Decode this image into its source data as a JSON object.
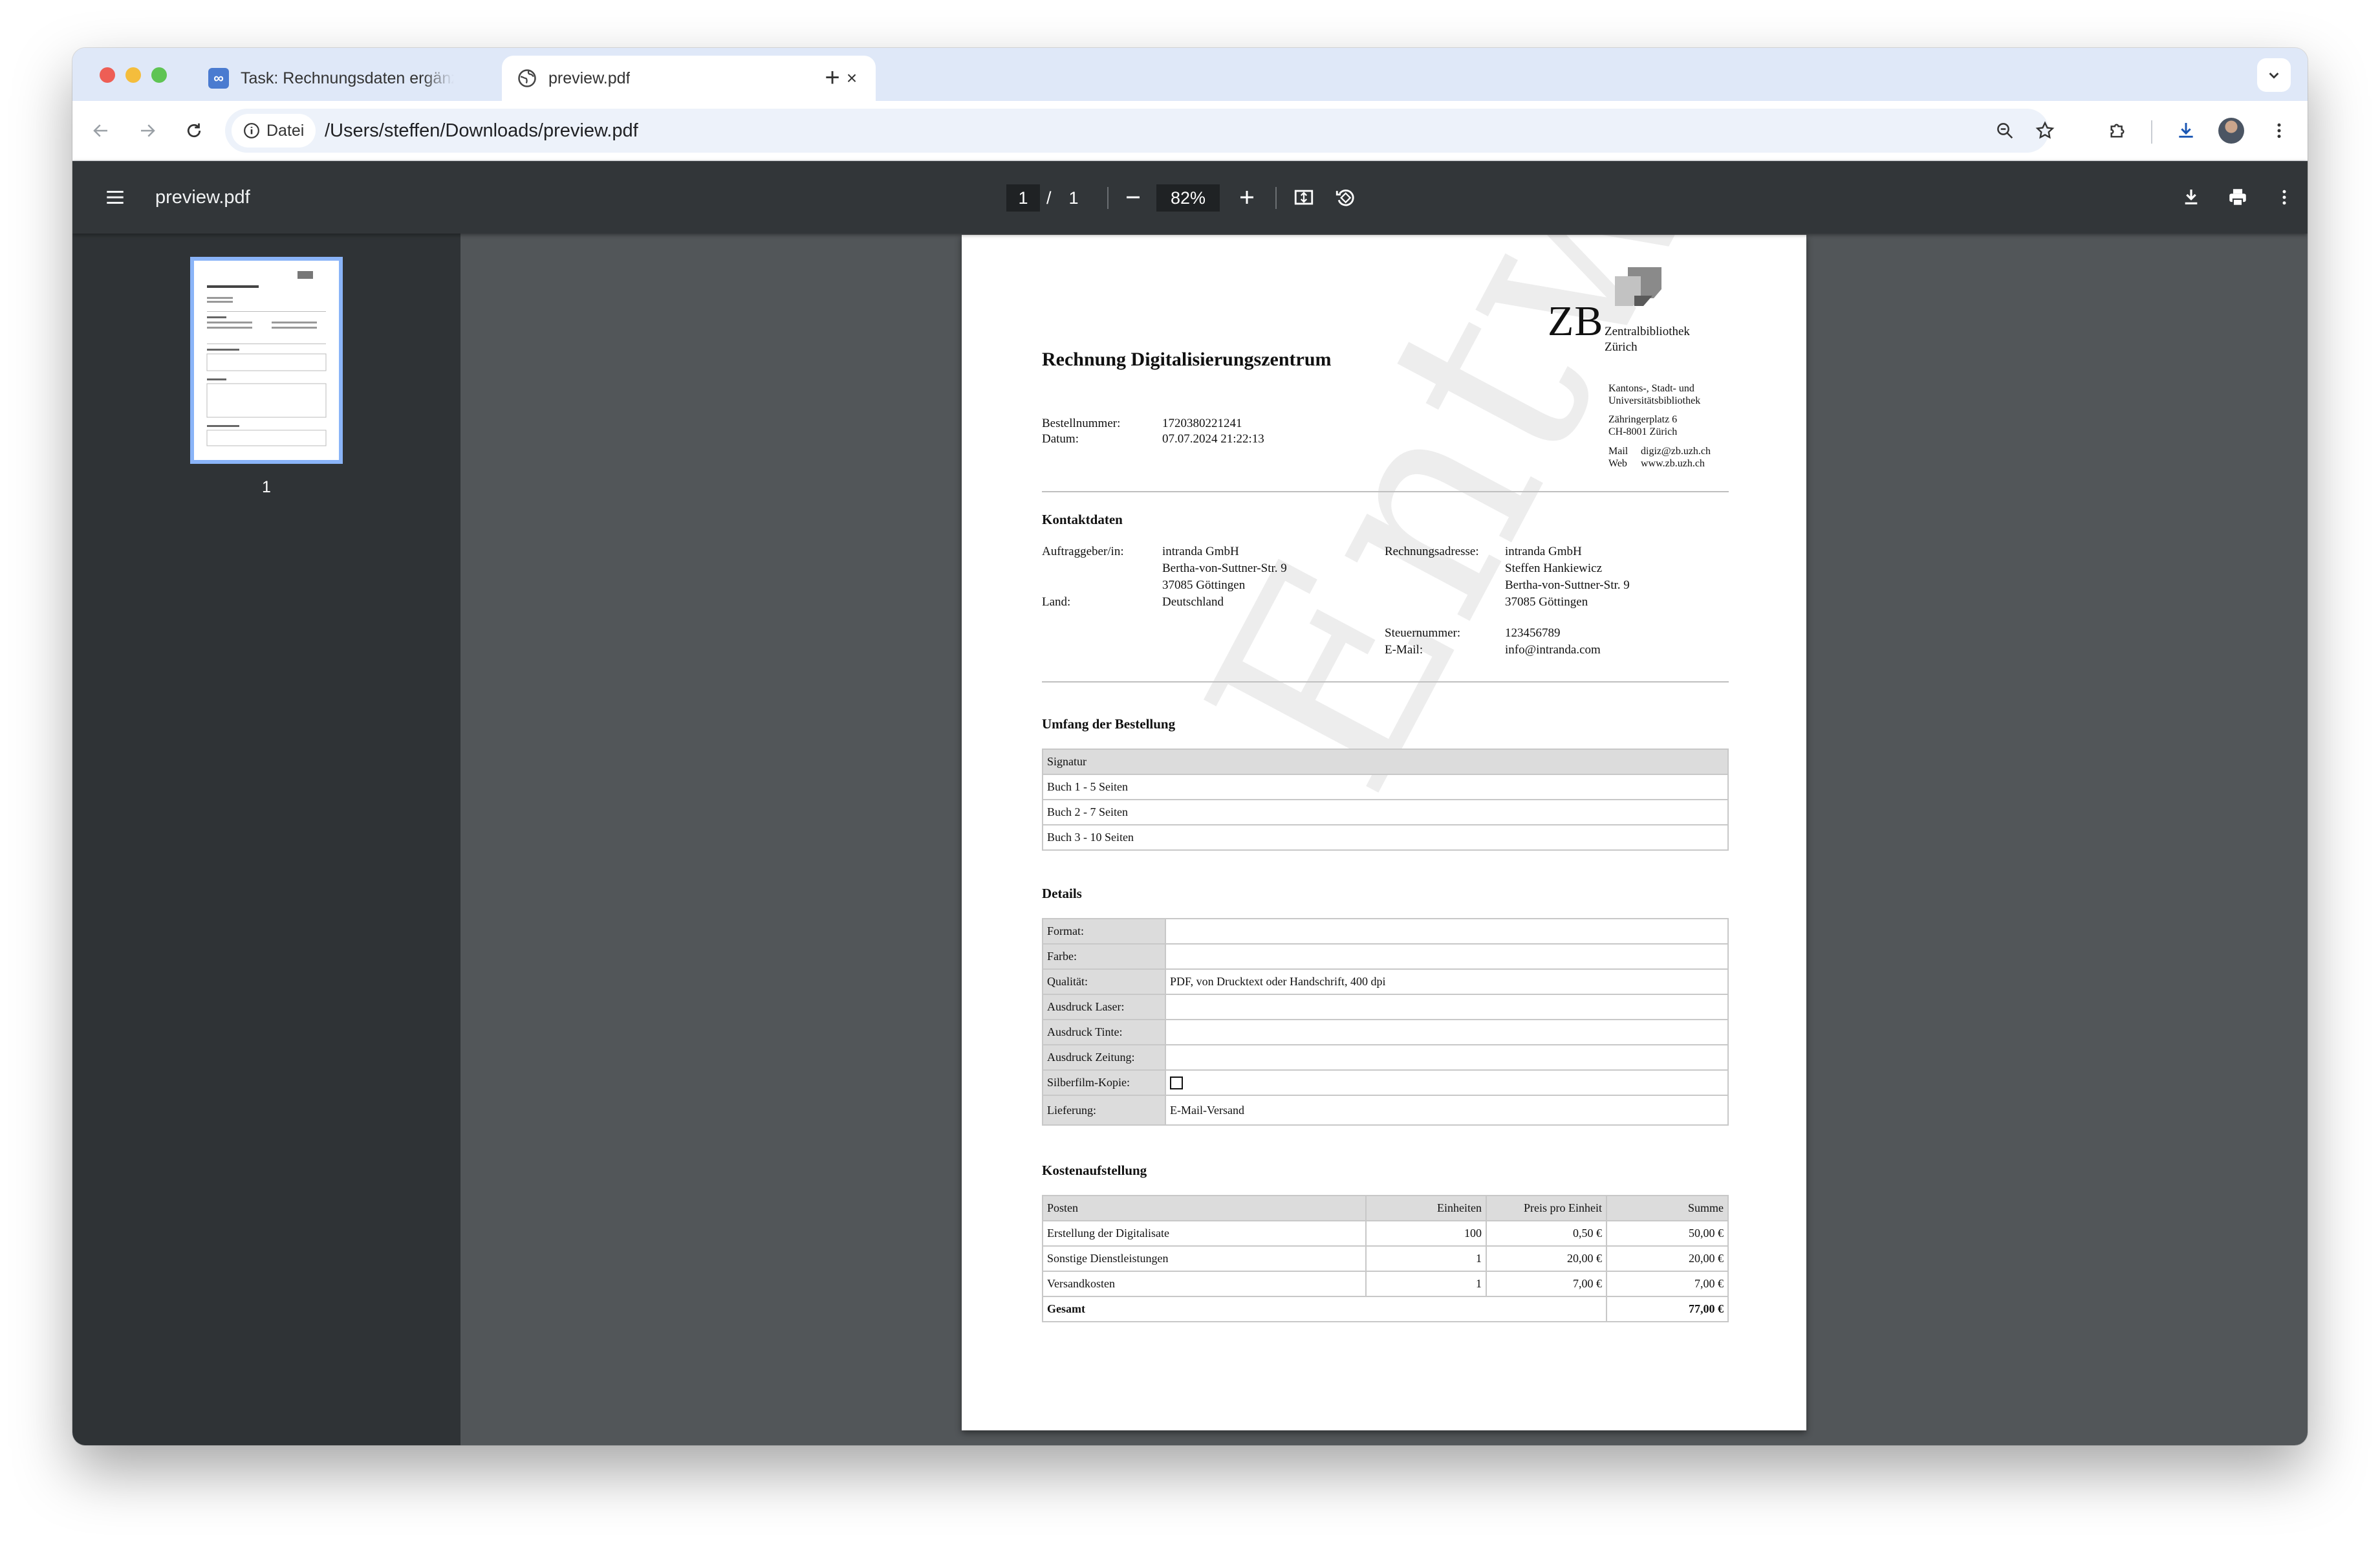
{
  "browser": {
    "tabs": [
      {
        "title": "Task: Rechnungsdaten ergänzen",
        "active": false
      },
      {
        "title": "preview.pdf",
        "active": true
      }
    ],
    "address": {
      "chip_label": "Datei",
      "url": "/Users/steffen/Downloads/preview.pdf"
    }
  },
  "viewer": {
    "title": "preview.pdf",
    "current_page": "1",
    "page_separator": "/",
    "total_pages": "1",
    "zoom": "82%",
    "thumbnail_label": "1"
  },
  "document": {
    "title": "Rechnung Digitalisierungszentrum",
    "logo": {
      "letters": "ZB",
      "line1": "Zentralbibliothek",
      "line2": "Zürich"
    },
    "library": {
      "line1": "Kantons-, Stadt- und",
      "line2": "Universitätsbibliothek",
      "street": "Zähringerplatz 6",
      "city": "CH-8001 Zürich",
      "mail_label": "Mail",
      "mail": "digiz@zb.uzh.ch",
      "web_label": "Web",
      "web": "www.zb.uzh.ch"
    },
    "order": {
      "number_label": "Bestellnummer:",
      "number": "1720380221241",
      "date_label": "Datum:",
      "date": "07.07.2024 21:22:13"
    },
    "contact": {
      "heading": "Kontaktdaten",
      "client_label": "Auftraggeber/in:",
      "client_lines": [
        "intranda GmbH",
        "Bertha-von-Suttner-Str. 9",
        "37085 Göttingen"
      ],
      "country_label": "Land:",
      "country": "Deutschland",
      "billing_label": "Rechnungsadresse:",
      "billing_lines": [
        "intranda GmbH",
        "Steffen Hankiewicz",
        "Bertha-von-Suttner-Str. 9",
        "37085 Göttingen"
      ],
      "tax_label": "Steuernummer:",
      "tax": "123456789",
      "email_label": "E-Mail:",
      "email": "info@intranda.com"
    },
    "scope": {
      "heading": "Umfang der Bestellung",
      "header": "Signatur",
      "rows": [
        "Buch 1 - 5 Seiten",
        "Buch 2 - 7 Seiten",
        "Buch 3 - 10 Seiten"
      ]
    },
    "details": {
      "heading": "Details",
      "rows": [
        {
          "label": "Format:",
          "value": ""
        },
        {
          "label": "Farbe:",
          "value": ""
        },
        {
          "label": "Qualität:",
          "value": "PDF, von Drucktext oder Handschrift, 400 dpi"
        },
        {
          "label": "Ausdruck Laser:",
          "value": ""
        },
        {
          "label": "Ausdruck Tinte:",
          "value": ""
        },
        {
          "label": "Ausdruck Zeitung:",
          "value": ""
        },
        {
          "label": "Silberfilm-Kopie:",
          "value": ""
        },
        {
          "label": "Lieferung:",
          "value": "E-Mail-Versand"
        }
      ]
    },
    "costs": {
      "heading": "Kostenaufstellung",
      "columns": [
        "Posten",
        "Einheiten",
        "Preis pro Einheit",
        "Summe"
      ],
      "rows": [
        [
          "Erstellung der Digitalisate",
          "100",
          "0,50 €",
          "50,00 €"
        ],
        [
          "Sonstige Dienstleistungen",
          "1",
          "20,00 €",
          "20,00 €"
        ],
        [
          "Versandkosten",
          "1",
          "7,00 €",
          "7,00 €"
        ]
      ],
      "total_label": "Gesamt",
      "total": "77,00 €"
    },
    "watermark": "Entwurf"
  }
}
